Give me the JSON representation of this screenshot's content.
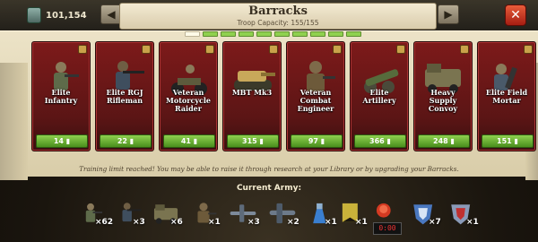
{
  "header": {
    "resource_value": "101,154",
    "resource_icon": "troop-stack-icon",
    "title": "Barracks",
    "capacity": "Troop Capacity: 155/155",
    "prev_icon": "arrow-left-icon",
    "next_icon": "arrow-right-icon",
    "close_icon": "close-icon",
    "close_color": "#d33a22"
  },
  "pager": {
    "pages": 10,
    "active_index": 0,
    "active_color": "#fffbe8",
    "page_color": "#8fd14f"
  },
  "units": [
    {
      "name": "Elite Infantry",
      "cost": "14",
      "icon": "infantry-icon"
    },
    {
      "name": "Elite RGJ Rifleman",
      "cost": "22",
      "icon": "rifleman-icon"
    },
    {
      "name": "Veteran Motorcycle Raider",
      "cost": "41",
      "icon": "motorcycle-icon"
    },
    {
      "name": "MBT Mk3",
      "cost": "315",
      "icon": "tank-icon"
    },
    {
      "name": "Veteran Combat Engineer",
      "cost": "97",
      "icon": "engineer-icon"
    },
    {
      "name": "Elite Artillery",
      "cost": "366",
      "icon": "artillery-icon"
    },
    {
      "name": "Heavy Supply Convoy",
      "cost": "248",
      "icon": "convoy-icon"
    },
    {
      "name": "Elite Field Mortar",
      "cost": "151",
      "icon": "mortar-icon"
    }
  ],
  "notice": "Training limit reached! You may be able to raise it through research at your Library or by upgrading your Barracks.",
  "army": {
    "title": "Current Army:",
    "slots": [
      {
        "icon": "infantry-icon",
        "count": "×62"
      },
      {
        "icon": "rifleman-icon",
        "count": "×3"
      },
      {
        "icon": "convoy-icon",
        "count": "×6"
      },
      {
        "icon": "engineer-icon",
        "count": "×1"
      },
      {
        "icon": "plane-icon",
        "count": "×3"
      },
      {
        "icon": "bomber-icon",
        "count": "×2"
      },
      {
        "icon": "flask-icon",
        "count": "×1"
      },
      {
        "icon": "banner-icon",
        "count": "×1"
      },
      {
        "icon": "alarm-button-icon",
        "count": "0:00"
      },
      {
        "icon": "shield-blue-icon",
        "count": "×7"
      },
      {
        "icon": "shield-red-icon",
        "count": "×1"
      }
    ]
  }
}
